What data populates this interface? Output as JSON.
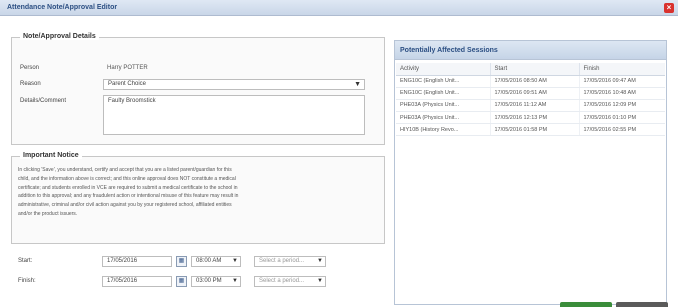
{
  "window": {
    "title": "Attendance Note/Approval Editor",
    "close_glyph": "×"
  },
  "details": {
    "legend": "Note/Approval Details",
    "person_label": "Person",
    "person_value": "Harry POTTER",
    "reason_label": "Reason",
    "reason_value": "Parent Choice",
    "comment_label": "Details/Comment",
    "comment_value": "Faulty Broomstick"
  },
  "notice": {
    "legend": "Important Notice",
    "lines": [
      "In clicking 'Save', you understand, certify and accept that you are a listed parent/guardian for this",
      "child, and the information above is correct; and this online approval does NOT constitute a medical",
      "certificate; and students enrolled in VCE are required to submit a medical certificate to the school in",
      "addition to this approval; and any fraudulent action or intentional misuse of this feature may result in",
      "administrative, criminal and/or civil action against you by your registered school, affiliated entities",
      "and/or the product issuers."
    ]
  },
  "start": {
    "label": "Start:",
    "date": "17/05/2016",
    "time": "08:00 AM",
    "period_placeholder": "Select a period..."
  },
  "finish": {
    "label": "Finish:",
    "date": "17/05/2016",
    "time": "03:00 PM",
    "period_placeholder": "Select a period..."
  },
  "sessions": {
    "title": "Potentially Affected Sessions",
    "columns": [
      "Activity",
      "Start",
      "Finish"
    ],
    "rows": [
      [
        "ENG10C (English Unit...",
        "17/05/2016 08:50 AM",
        "17/05/2016 09:47 AM"
      ],
      [
        "ENG10C (English Unit...",
        "17/05/2016 09:51 AM",
        "17/05/2016 10:48 AM"
      ],
      [
        "PHE03A (Physics Unit...",
        "17/05/2016 11:12 AM",
        "17/05/2016 12:09 PM"
      ],
      [
        "PHE03A (Physics Unit...",
        "17/05/2016 12:13 PM",
        "17/05/2016 01:10 PM"
      ],
      [
        "HIY10B (History Revo...",
        "17/05/2016 01:58 PM",
        "17/05/2016 02:55 PM"
      ]
    ]
  },
  "icons": {
    "calendar": "calendar-icon",
    "dropdown": "chevron-down-icon",
    "close": "close-icon"
  },
  "colors": {
    "accent": "#2c4f83",
    "close": "#d9322e",
    "ok_button": "#3a8d3a",
    "cancel_button": "#5a5a5a"
  }
}
